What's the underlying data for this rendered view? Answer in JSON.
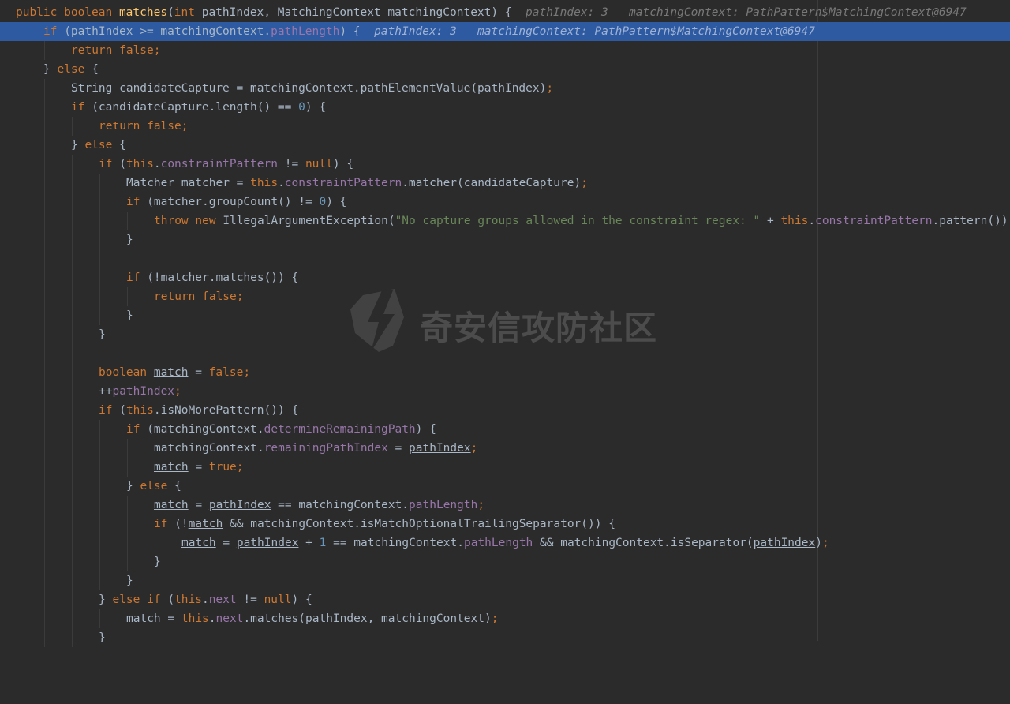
{
  "debug_hints": {
    "method_path_index": "pathIndex: 3",
    "method_matching_context": "matchingContext: PathPattern$MatchingContext@6947",
    "if_path_index": "pathIndex: 3",
    "if_matching_context": "matchingContext: PathPattern$MatchingContext@6947"
  },
  "strings": {
    "constraint_error": "\"No capture groups allowed in the constraint regex: \""
  },
  "watermark": {
    "text": "奇安信攻防社区"
  },
  "colors": {
    "highlight": "#2d5aa0",
    "keyword": "#cc7832",
    "field": "#9876aa",
    "method": "#ffc66d",
    "number": "#6897bb",
    "string": "#6a8759"
  }
}
